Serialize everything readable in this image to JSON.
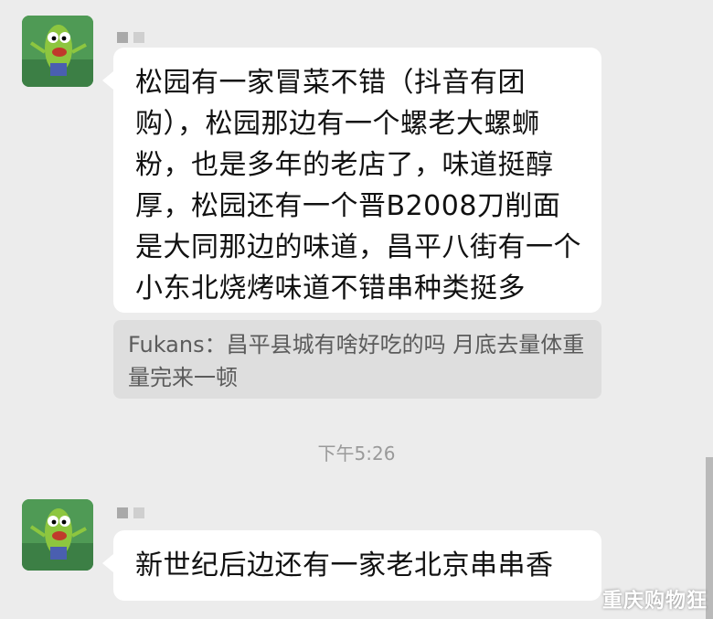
{
  "messages": [
    {
      "sender": "■ ■",
      "text": "松园有一家冒菜不错（抖音有团购），松园那边有一个螺老大螺蛳粉，也是多年的老店了，味道挺醇厚，松园还有一个晋B2008刀削面是大同那边的味道，昌平八街有一个小东北烧烤味道不错串种类挺多",
      "quote": "Fukans：昌平县城有啥好吃的吗 月底去量体重 量完来一顿"
    },
    {
      "sender": "■ ■",
      "text": "新世纪后边还有一家老北京串串香"
    }
  ],
  "timestamp": "下午5:26",
  "watermark": "重庆购物狂",
  "colors": {
    "background": "#ececec",
    "bubble": "#ffffff",
    "quote_bg": "#dedede",
    "avatar_bg": "#5a9e5c"
  },
  "icons": {
    "avatar": "cartoon-pickle-avatar-icon"
  }
}
